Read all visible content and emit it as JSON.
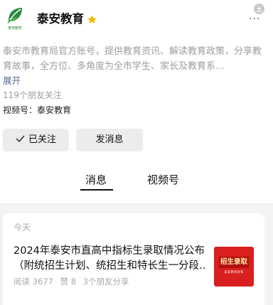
{
  "account": {
    "logo_caption": "泰安教育",
    "name": "泰安教育",
    "starred": true,
    "description": "泰安市教育局官方账号，提供教育资讯、解读教育政策，分享教育故事，全方位、多角度为全市学生、家长及教育系...",
    "expand_label": "展开",
    "followers": "119个朋友关注",
    "channel": "视频号：泰安教育"
  },
  "icons": {
    "logo": "leaf-logo-icon",
    "star": "star-icon",
    "exit": "exit-icon",
    "more": "more-icon",
    "check": "check-icon"
  },
  "actions": {
    "follow_label": "已关注",
    "message_label": "发消息"
  },
  "tabs": [
    {
      "label": "消息",
      "active": true
    },
    {
      "label": "视频号",
      "active": false
    }
  ],
  "feed": {
    "date_label": "今天",
    "article": {
      "title_line1": "2024年泰安市直高中指标生录取情况公布",
      "title_line2": "（附统招生计划、统招生和特长生一分段…",
      "reads": "阅读 3677",
      "likes": "赞 8",
      "shares": "3个朋友分享",
      "thumb_title": "招生录取",
      "thumb_sub": "泰安教育发布"
    }
  },
  "colors": {
    "accent_star": "#f5b800",
    "link": "#576b95",
    "brand_green": "#2a8a3e",
    "thumb_red": "#d91f1f"
  }
}
